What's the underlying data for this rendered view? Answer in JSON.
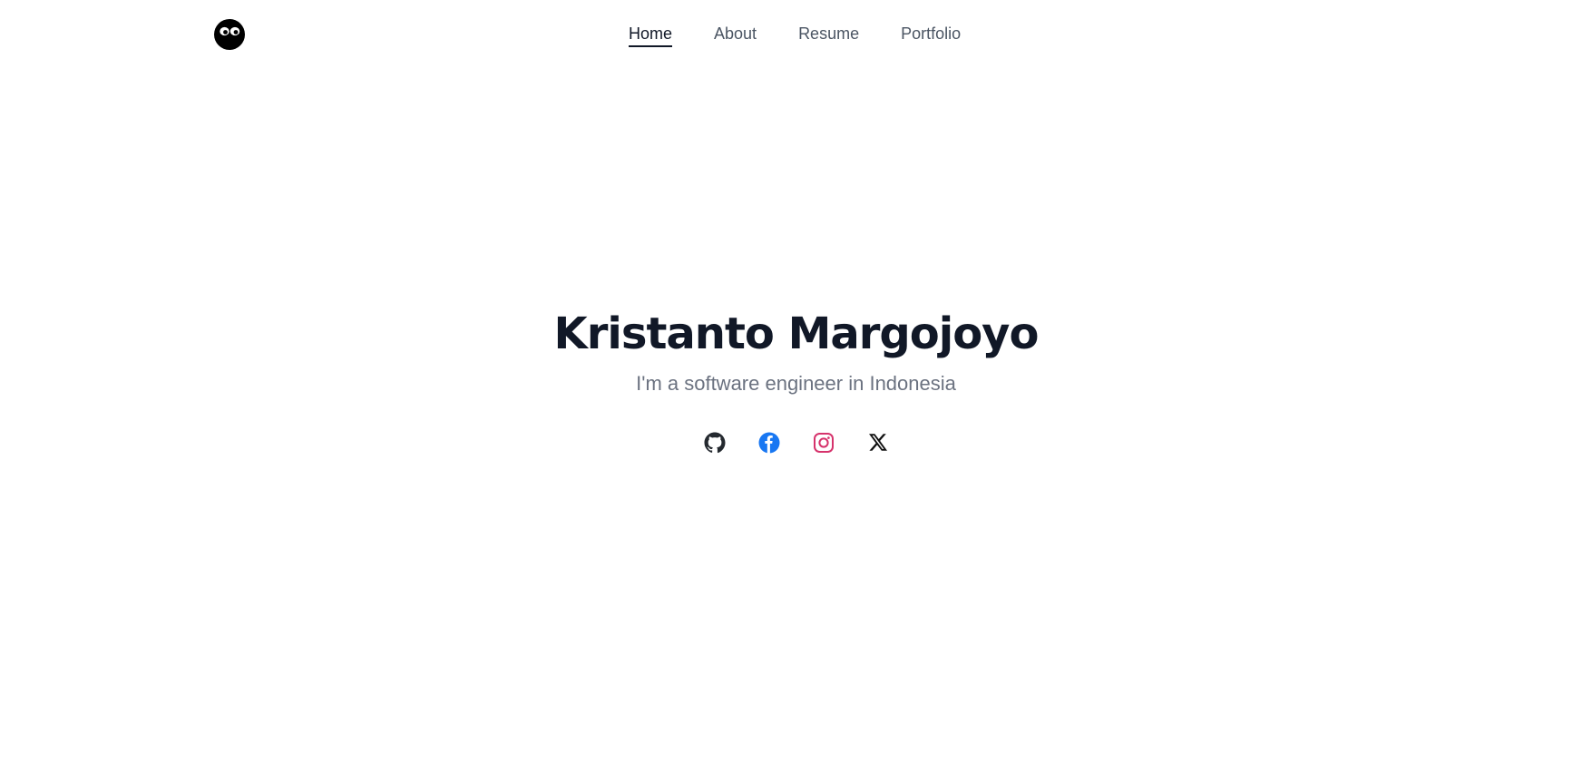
{
  "header": {
    "logo_name": "avatar-logo",
    "nav": [
      {
        "label": "Home",
        "active": true
      },
      {
        "label": "About",
        "active": false
      },
      {
        "label": "Resume",
        "active": false
      },
      {
        "label": "Portfolio",
        "active": false
      }
    ]
  },
  "hero": {
    "name": "Kristanto Margojoyo",
    "tagline": "I'm a software engineer in Indonesia"
  },
  "socials": [
    {
      "icon": "github-icon",
      "color": "#24292f"
    },
    {
      "icon": "facebook-icon",
      "color": "#1877f2"
    },
    {
      "icon": "instagram-icon",
      "color": "#d6336c"
    },
    {
      "icon": "x-icon",
      "color": "#111111"
    }
  ]
}
